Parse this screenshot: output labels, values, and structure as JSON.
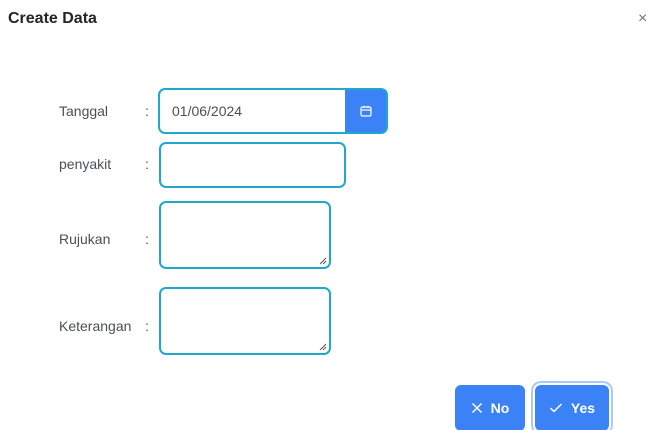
{
  "dialog": {
    "title": "Create Data",
    "close_glyph": "×"
  },
  "form": {
    "separator": ":",
    "tanggal": {
      "label": "Tanggal",
      "value": "01/06/2024",
      "button_icon": "calendar-icon"
    },
    "penyakit": {
      "label": "penyakit",
      "value": ""
    },
    "rujukan": {
      "label": "Rujukan",
      "value": ""
    },
    "keterangan": {
      "label": "Keterangan",
      "value": ""
    }
  },
  "actions": {
    "no_label": "No",
    "no_icon": "times-icon",
    "yes_label": "Yes",
    "yes_icon": "check-icon"
  },
  "colors": {
    "primary": "#3b82f6",
    "input_border": "#1fa8c9",
    "text": "#495057"
  }
}
